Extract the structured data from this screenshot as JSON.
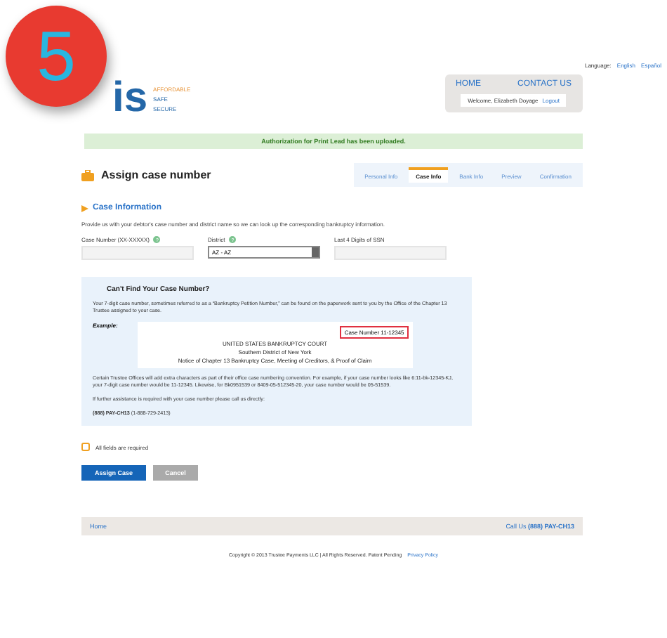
{
  "step_badge": "5",
  "language": {
    "label": "Language:",
    "links": [
      "English",
      "Español"
    ]
  },
  "logo": {
    "mark": "is",
    "tagline": [
      "AFFORDABLE",
      "SAFE",
      "SECURE"
    ]
  },
  "nav": {
    "links": [
      "HOME",
      "CONTACT US"
    ],
    "welcome": "Welcome, Elizabeth Doyage",
    "logout": "Logout"
  },
  "banner": "Authorization for Print Lead has been uploaded.",
  "page_title": "Assign case number",
  "steps": [
    {
      "label": "Personal Info",
      "selected": false
    },
    {
      "label": "Case Info",
      "selected": true
    },
    {
      "label": "Bank Info",
      "selected": false
    },
    {
      "label": "Preview",
      "selected": false
    },
    {
      "label": "Confirmation",
      "selected": false
    }
  ],
  "section_title": "Case Information",
  "description": "Provide us with your debtor's case number and district name so we can look up the corresponding bankruptcy information.",
  "fields": [
    {
      "kind": "text",
      "label": "Case Number (XX-XXXXX)",
      "help": "?"
    },
    {
      "kind": "select",
      "label": "District",
      "help": "?",
      "value": "AZ - AZ"
    },
    {
      "kind": "text",
      "label": "Last 4 Digits of SSN"
    }
  ],
  "help_box": {
    "title": "Can't Find Your Case Number?",
    "intro": "Your 7-digit case number, sometimes referred to as a “Bankruptcy Petition Number,” can be found on the paperwork sent to you by the Office of the Chapter 13 Trustee assigned to your case.",
    "example_label": "Example:",
    "example_doc": {
      "lines": [
        "UNITED STATES BANKRUPTCY COURT",
        "Southern District of New York",
        "Notice of Chapter 13 Bankruptcy Case, Meeting of Creditors, & Proof of Claim"
      ],
      "case_number": "Case Number 11-12345"
    },
    "note": "Certain Trustee Offices will add extra characters as part of their office case numbering convention. For example, if your case number looks like 6:11-bk-12345-KJ, your 7-digit case number would be 11-12345. Likewise, for Bk0951539 or 8409-05-512345-20, your case number would be 05-51539.",
    "contact_intro": "If further assistance is required with your case number please call us directly:",
    "phone": "**(888) PAY-CH13** (1-888-729-2413)"
  },
  "required_note": "All fields are required",
  "buttons": [
    {
      "kind": "primary",
      "label": "Assign Case"
    },
    {
      "kind": "secondary",
      "label": "Cancel"
    }
  ],
  "footer": {
    "home": "Home",
    "call_label": "Call Us",
    "call_number": "(888) PAY-CH13"
  },
  "copyright": {
    "text": "Copyright © 2013 Trustee Payments LLC | All Rights Reserved. Patent Pending",
    "link": "Privacy Policy"
  }
}
